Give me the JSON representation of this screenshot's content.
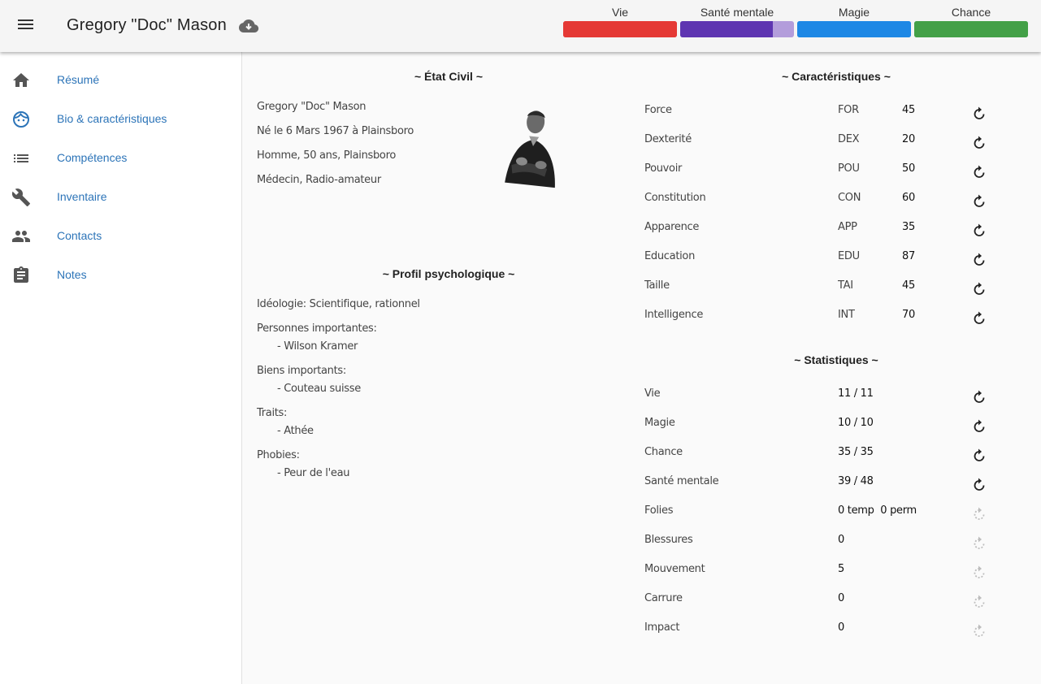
{
  "app": {
    "title": "Gregory \"Doc\" Mason"
  },
  "icons": {
    "menu": "menu-icon",
    "cloud": "cloud-download-icon",
    "reroll": "rotate-right-icon"
  },
  "gauges": [
    {
      "label": "Vie",
      "color": "#e53935",
      "fill": 1.0
    },
    {
      "label": "Santé mentale",
      "color": "#5e35b1",
      "track": "#b39ddb",
      "fill": 0.8125
    },
    {
      "label": "Magie",
      "color": "#1e88e5",
      "fill": 1.0
    },
    {
      "label": "Chance",
      "color": "#43a047",
      "fill": 1.0
    }
  ],
  "sidebar": {
    "items": [
      {
        "label": "Résumé",
        "icon": "home-icon"
      },
      {
        "label": "Bio & caractéristiques",
        "icon": "face-icon"
      },
      {
        "label": "Compétences",
        "icon": "list-icon"
      },
      {
        "label": "Inventaire",
        "icon": "wrench-icon"
      },
      {
        "label": "Contacts",
        "icon": "people-icon"
      },
      {
        "label": "Notes",
        "icon": "clipboard-icon"
      }
    ]
  },
  "etat_civil": {
    "title": "~ État Civil ~",
    "lines": [
      "Gregory \"Doc\" Mason",
      "Né le 6 Mars 1967 à Plainsboro",
      "Homme, 50 ans, Plainsboro",
      "Médecin, Radio-amateur"
    ]
  },
  "profil": {
    "title": "~ Profil psychologique ~",
    "ideologie": "Idéologie: Scientifique, rationnel",
    "groups": [
      {
        "label": "Personnes importantes:",
        "item": "- Wilson Kramer"
      },
      {
        "label": "Biens importants:",
        "item": "- Couteau suisse"
      },
      {
        "label": "Traits:",
        "item": "- Athée"
      },
      {
        "label": "Phobies:",
        "item": "- Peur de l'eau"
      }
    ]
  },
  "caracteristiques": {
    "title": "~ Caractéristiques ~",
    "rows": [
      {
        "name": "Force",
        "abbr": "FOR",
        "value": "45"
      },
      {
        "name": "Dexterité",
        "abbr": "DEX",
        "value": "20"
      },
      {
        "name": "Pouvoir",
        "abbr": "POU",
        "value": "50"
      },
      {
        "name": "Constitution",
        "abbr": "CON",
        "value": "60"
      },
      {
        "name": "Apparence",
        "abbr": "APP",
        "value": "35"
      },
      {
        "name": "Education",
        "abbr": "EDU",
        "value": "87"
      },
      {
        "name": "Taille",
        "abbr": "TAI",
        "value": "45"
      },
      {
        "name": "Intelligence",
        "abbr": "INT",
        "value": "70"
      }
    ]
  },
  "statistiques": {
    "title": "~ Statistiques ~",
    "rows": [
      {
        "name": "Vie",
        "value": "11 / 11",
        "active": true
      },
      {
        "name": "Magie",
        "value": "10 / 10",
        "active": true
      },
      {
        "name": "Chance",
        "value": "35 / 35",
        "active": true
      },
      {
        "name": "Santé mentale",
        "value": "39 / 48",
        "active": true
      },
      {
        "name": "Folies",
        "value": "0 temp  0 perm",
        "active": false
      },
      {
        "name": "Blessures",
        "value": "0",
        "active": false
      },
      {
        "name": "Mouvement",
        "value": "5",
        "active": false
      },
      {
        "name": "Carrure",
        "value": "0",
        "active": false
      },
      {
        "name": "Impact",
        "value": "0",
        "active": false
      }
    ]
  }
}
